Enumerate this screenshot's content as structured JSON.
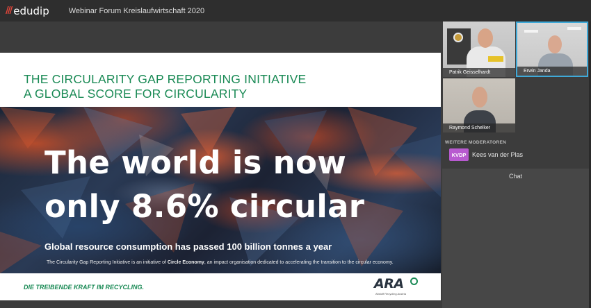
{
  "brand": {
    "logo_text": "edudip"
  },
  "webinar": {
    "title": "Webinar Forum Kreislaufwirtschaft 2020"
  },
  "slide": {
    "title_line1": "THE CIRCULARITY GAP REPORTING INITIATIVE",
    "title_line2": "A GLOBAL SCORE FOR CIRCULARITY",
    "headline_line1": "The world is now",
    "headline_line2": "only 8.6% circular",
    "subline": "Global resource consumption has passed 100 billion tonnes a year",
    "footnote_pre": "The Circularity Gap Reporting Initiative is an initiative of ",
    "footnote_bold": "Circle Economy",
    "footnote_post": ", an impact organisation dedicated to accelerating the transition to the circular economy.",
    "tagline": "DIE TREIBENDE KRAFT IM RECYCLING.",
    "ara_logo": "ARA",
    "ara_sub": "Altstoff Recycling Austria"
  },
  "participants": [
    {
      "name": "Patrik Geisselhardt"
    },
    {
      "name": "Erwin Janda"
    },
    {
      "name": "Raymond Schelker"
    }
  ],
  "moderators": {
    "header": "WEITERE MODERATOREN",
    "items": [
      {
        "initials": "KVDP",
        "name": "Kees van der Plas"
      }
    ]
  },
  "chat": {
    "title": "Chat"
  },
  "colors": {
    "accent_green": "#1a8a55",
    "active_speaker": "#3fa9d8",
    "moderator_badge": "#b85ad0",
    "brand_red": "#e8463a"
  }
}
